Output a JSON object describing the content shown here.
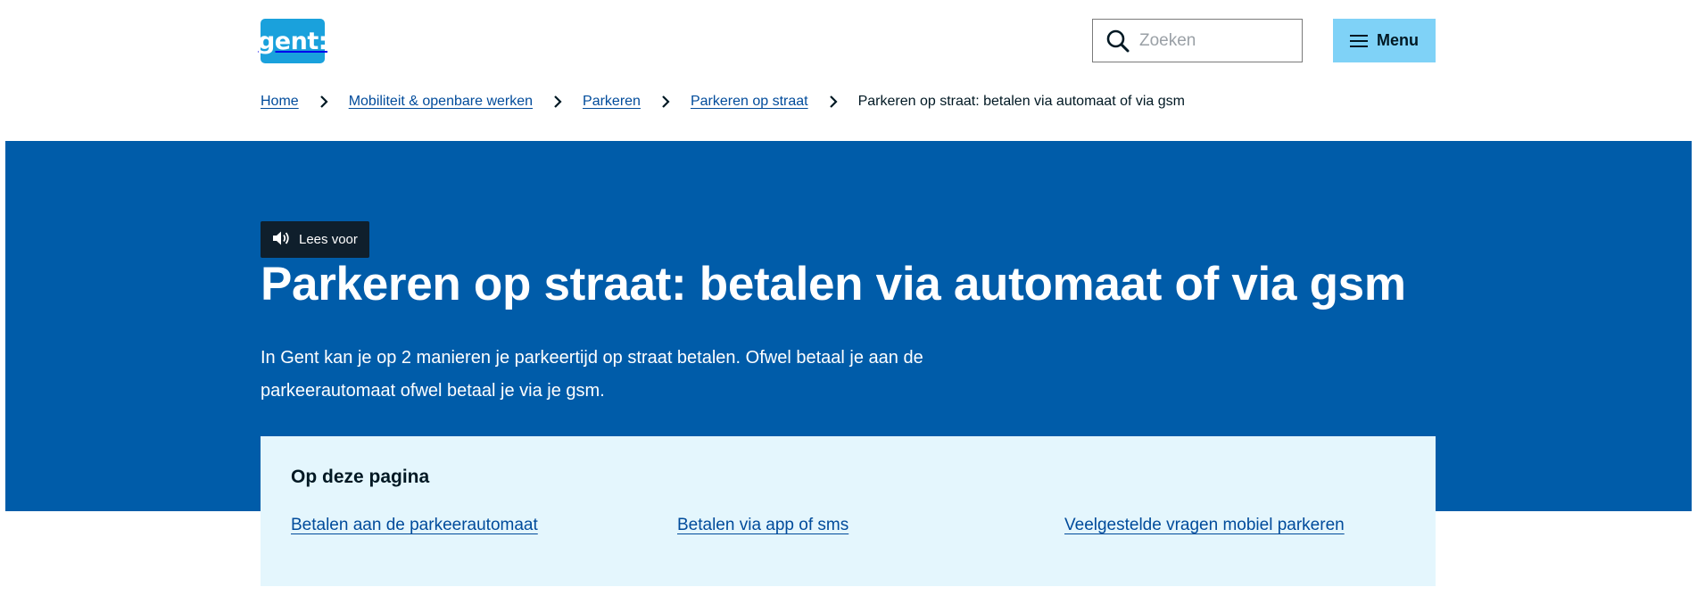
{
  "header": {
    "logo_text": "gent:",
    "search": {
      "placeholder": "Zoeken",
      "value": ""
    },
    "menu_label": "Menu"
  },
  "breadcrumb": {
    "items": [
      "Home",
      "Mobiliteit & openbare werken",
      "Parkeren",
      "Parkeren op straat"
    ],
    "current": "Parkeren op straat: betalen via automaat of via gsm"
  },
  "hero": {
    "listen_label": "Lees voor",
    "title": "Parkeren op straat: betalen via automaat of via gsm",
    "intro": "In Gent kan je op 2 manieren je parkeertijd op straat betalen. Ofwel betaal je aan de parkeerautomaat ofwel betaal je via je gsm."
  },
  "toc": {
    "title": "Op deze pagina",
    "links": [
      "Betalen aan de parkeerautomaat",
      "Betalen via app of sms",
      "Veelgestelde vragen mobiel parkeren"
    ]
  },
  "colors": {
    "brand_blue": "#005ca9",
    "logo_blue": "#1aa1dc",
    "menu_button": "#7fd2f7",
    "toc_background": "#e4f6fd",
    "link": "#004b9b"
  }
}
